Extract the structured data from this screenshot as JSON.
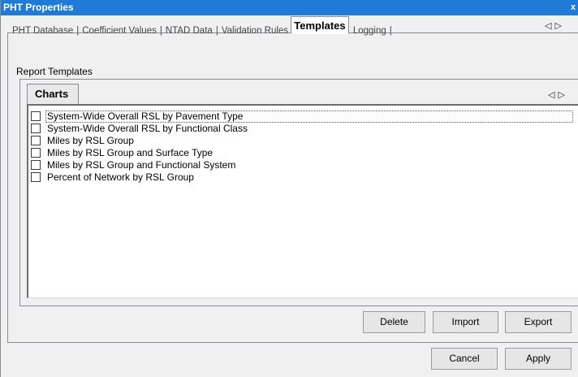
{
  "window": {
    "title": "PHT Properties",
    "close_glyph": "x"
  },
  "tabs": [
    {
      "label": "PHT Database"
    },
    {
      "label": "Coefficient Values"
    },
    {
      "label": "NTAD Data"
    },
    {
      "label": "Validation Rules"
    },
    {
      "label": "Templates",
      "active": true
    },
    {
      "label": "Logging"
    }
  ],
  "tab_separator": "|",
  "scroll_arrows": {
    "left": "◁",
    "right": "▷"
  },
  "section": {
    "label": "Report Templates"
  },
  "inner_tab": {
    "label": "Charts"
  },
  "templates": [
    {
      "label": "System-Wide Overall RSL by Pavement Type",
      "checked": false,
      "focused": true
    },
    {
      "label": "System-Wide Overall RSL by Functional Class",
      "checked": false
    },
    {
      "label": "Miles by RSL Group",
      "checked": false
    },
    {
      "label": "Miles by RSL Group and Surface Type",
      "checked": false
    },
    {
      "label": "Miles by RSL Group and Functional System",
      "checked": false
    },
    {
      "label": "Percent of Network by RSL Group",
      "checked": false
    }
  ],
  "buttons": {
    "delete": "Delete",
    "import": "Import",
    "export": "Export",
    "cancel": "Cancel",
    "apply": "Apply"
  },
  "colors": {
    "titlebar": "#1f7bd6",
    "window_bg": "#f0f0f0"
  }
}
